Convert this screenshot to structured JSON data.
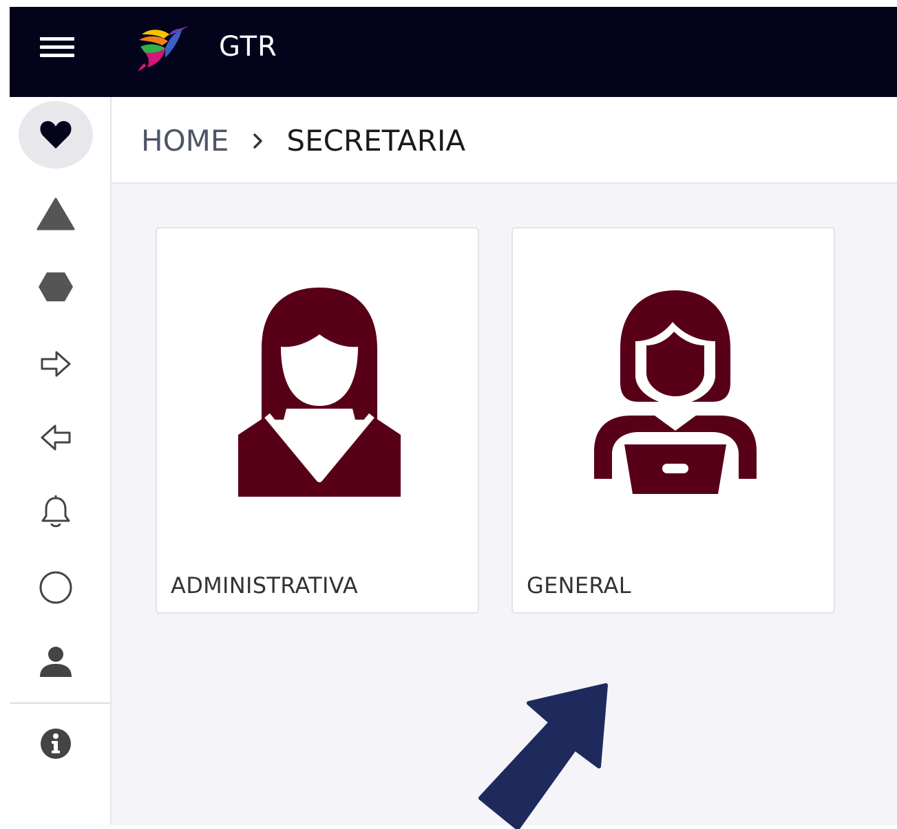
{
  "app": {
    "title": "GTR",
    "brand_color": "#03031c",
    "accent_color": "#580018"
  },
  "topbar": {
    "menu_icon": "hamburger-menu-icon",
    "logo": "hummingbird-logo"
  },
  "sidebar": {
    "items": [
      {
        "icon": "heart-icon",
        "active": true
      },
      {
        "icon": "triangle-icon"
      },
      {
        "icon": "hexagon-icon"
      },
      {
        "icon": "arrow-right-outline-icon"
      },
      {
        "icon": "arrow-left-outline-icon"
      },
      {
        "icon": "bell-icon"
      },
      {
        "icon": "circle-outline-icon"
      },
      {
        "icon": "user-icon"
      },
      {
        "icon": "info-icon"
      }
    ]
  },
  "breadcrumb": {
    "home": "HOME",
    "separator_icon": "chevron-right-icon",
    "current": "SECRETARIA"
  },
  "cards": [
    {
      "label": "ADMINISTRATIVA",
      "icon": "woman-administrative-icon"
    },
    {
      "label": "GENERAL",
      "icon": "woman-laptop-icon"
    }
  ],
  "annotation": {
    "icon": "pointer-arrow-icon",
    "color": "#1f2a5c"
  }
}
